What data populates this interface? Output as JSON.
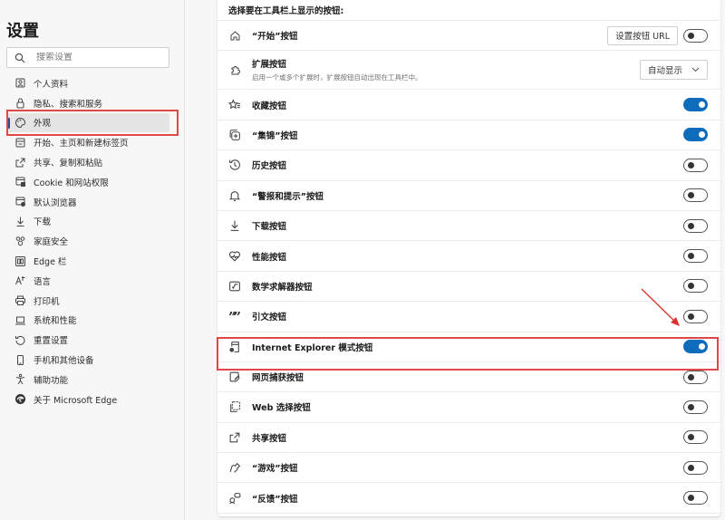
{
  "sidebar": {
    "title": "设置",
    "search_placeholder": "搜索设置",
    "items": [
      {
        "label": "个人资料",
        "icon": "profile-icon",
        "active": false
      },
      {
        "label": "隐私、搜索和服务",
        "icon": "lock-icon",
        "active": false
      },
      {
        "label": "外观",
        "icon": "palette-icon",
        "active": true
      },
      {
        "label": "开始、主页和新建标签页",
        "icon": "home-tabs-icon",
        "active": false
      },
      {
        "label": "共享、复制和粘贴",
        "icon": "share-icon",
        "active": false
      },
      {
        "label": "Cookie 和网站权限",
        "icon": "site-permissions-icon",
        "active": false
      },
      {
        "label": "默认浏览器",
        "icon": "default-browser-icon",
        "active": false
      },
      {
        "label": "下载",
        "icon": "download-icon",
        "active": false
      },
      {
        "label": "家庭安全",
        "icon": "family-icon",
        "active": false
      },
      {
        "label": "Edge 栏",
        "icon": "edge-bar-icon",
        "active": false
      },
      {
        "label": "语言",
        "icon": "language-icon",
        "active": false
      },
      {
        "label": "打印机",
        "icon": "printer-icon",
        "active": false
      },
      {
        "label": "系统和性能",
        "icon": "laptop-icon",
        "active": false
      },
      {
        "label": "重置设置",
        "icon": "reset-icon",
        "active": false
      },
      {
        "label": "手机和其他设备",
        "icon": "phone-icon",
        "active": false
      },
      {
        "label": "辅助功能",
        "icon": "accessibility-icon",
        "active": false
      },
      {
        "label": "关于 Microsoft Edge",
        "icon": "edge-logo-icon",
        "active": false
      }
    ]
  },
  "main": {
    "section_header": "选择要在工具栏上显示的按钮:",
    "home_row": {
      "label": "“开始”按钮",
      "button_label": "设置按钮 URL",
      "enabled": false
    },
    "extensions_row": {
      "label": "扩展按钮",
      "description": "启用一个或多个扩展时，扩展按钮自动出现在工具栏中。",
      "select_value": "自动显示"
    },
    "toggle_rows": [
      {
        "label": "收藏按钮",
        "icon": "favorites-icon",
        "enabled": true
      },
      {
        "label": "“集锦”按钮",
        "icon": "collections-icon",
        "enabled": true
      },
      {
        "label": "历史按钮",
        "icon": "history-icon",
        "enabled": false
      },
      {
        "label": "“警报和提示”按钮",
        "icon": "bell-icon",
        "enabled": false
      },
      {
        "label": "下载按钮",
        "icon": "download-icon",
        "enabled": false
      },
      {
        "label": "性能按钮",
        "icon": "performance-icon",
        "enabled": false
      },
      {
        "label": "数学求解器按钮",
        "icon": "math-solver-icon",
        "enabled": false
      },
      {
        "label": "引文按钮",
        "icon": "quote-icon",
        "enabled": false
      },
      {
        "label": "Internet Explorer 模式按钮",
        "icon": "ie-mode-icon",
        "enabled": true
      },
      {
        "label": "网页捕获按钮",
        "icon": "web-capture-icon",
        "enabled": false
      },
      {
        "label": "Web 选择按钮",
        "icon": "web-select-icon",
        "enabled": false
      },
      {
        "label": "共享按钮",
        "icon": "share-icon",
        "enabled": false
      },
      {
        "label": "“游戏”按钮",
        "icon": "games-icon",
        "enabled": false
      },
      {
        "label": "“反馈”按钮",
        "icon": "feedback-icon",
        "enabled": false
      }
    ]
  },
  "colors": {
    "accent": "#0f6cbd",
    "highlight": "#e04848",
    "sidebar_active_bar": "#2a4a9c"
  }
}
